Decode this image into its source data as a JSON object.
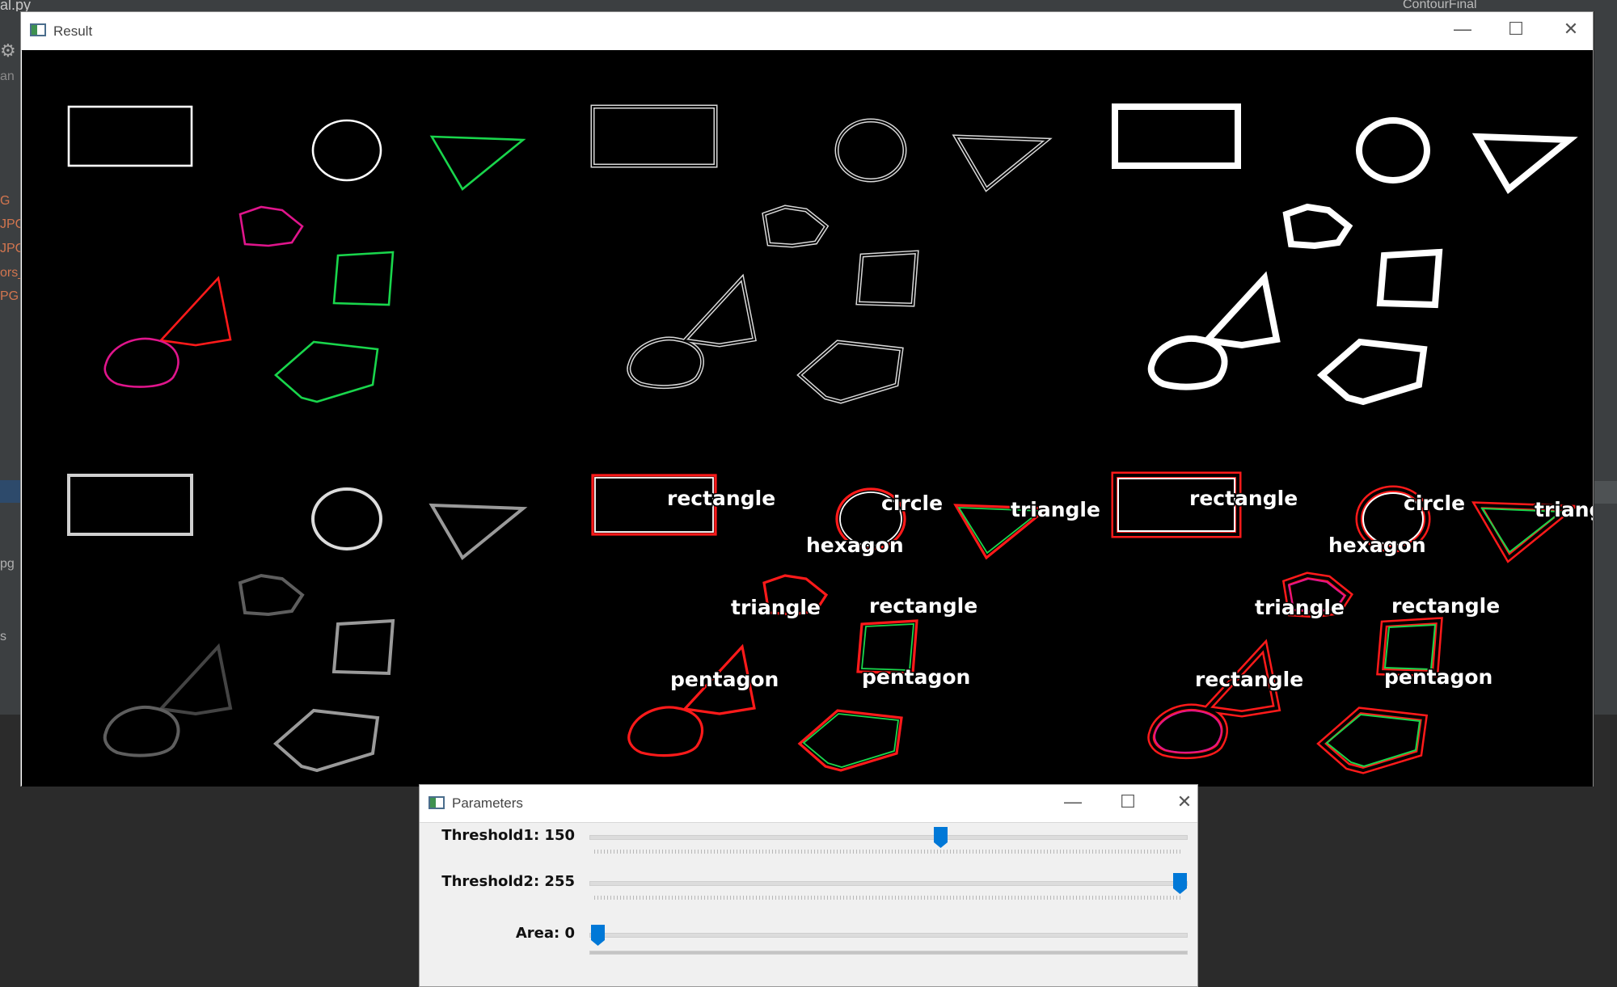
{
  "ide": {
    "filename_fragment": "al.py",
    "run_config": "ContourFinal",
    "side_items": [
      "an",
      "G",
      "JPG",
      "JPG",
      "ors_",
      "PG",
      "pg",
      "s"
    ]
  },
  "result_window": {
    "title": "Result",
    "controls": {
      "minimize": "—",
      "maximize": "☐",
      "close": "✕"
    },
    "labels": {
      "p5": [
        "rectangle",
        "circle",
        "triangle",
        "hexagon",
        "triangle",
        "rectangle",
        "pentagon",
        "pentagon"
      ],
      "p6": [
        "rectangle",
        "circle",
        "triangle",
        "hexagon",
        "triangle",
        "rectangle",
        "rectangle",
        "pentagon"
      ]
    },
    "colors": {
      "red": "#ff1a1a",
      "green": "#19d64c",
      "magenta": "#e0158c",
      "white": "#ffffff",
      "background": "#000000"
    }
  },
  "parameters_window": {
    "title": "Parameters",
    "controls": {
      "minimize": "—",
      "maximize": "☐",
      "close": "✕"
    },
    "trackbars": [
      {
        "label": "Threshold1: 150",
        "value": 150,
        "max": 255
      },
      {
        "label": "Threshold2: 255",
        "value": 255,
        "max": 255
      },
      {
        "label": "Area: 0",
        "value": 0,
        "max": 30000
      }
    ],
    "thumb_color": "#0078d7"
  }
}
